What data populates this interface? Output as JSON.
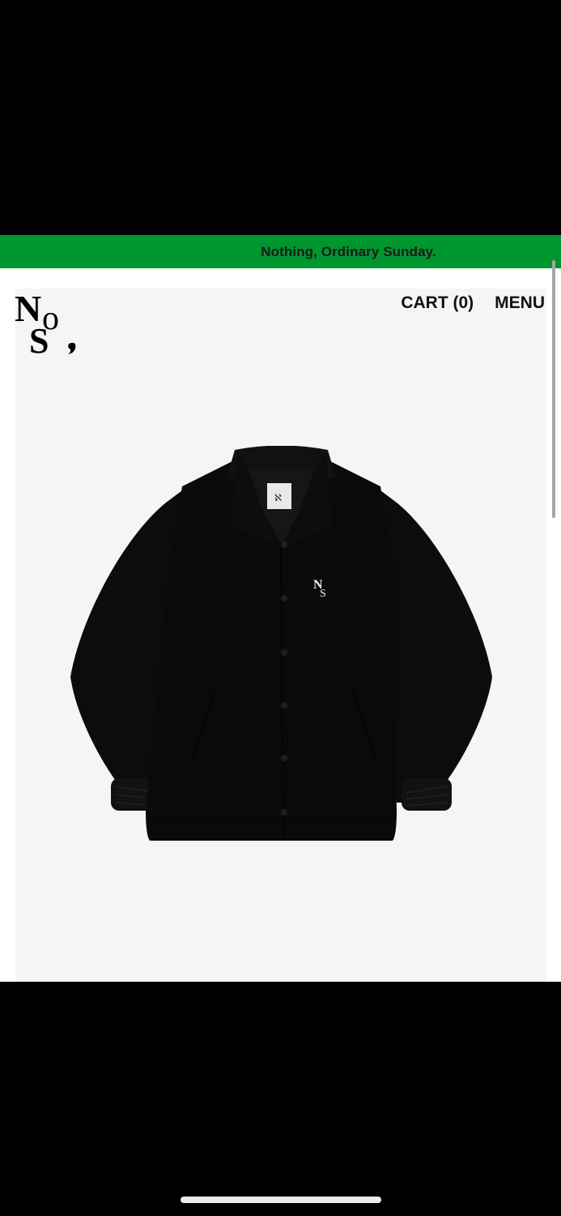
{
  "banner": {
    "text": "Nothing, Ordinary Sunday.",
    "background_color": "#00962f"
  },
  "header": {
    "logo_icon": "nos-monogram-logo-icon",
    "cart_label": "CART (0)",
    "menu_label": "MENU"
  },
  "product": {
    "image_icon": "black-coach-jacket-image",
    "background_color": "#f5f5f5"
  },
  "colors": {
    "accent": "#00962f",
    "text": "#111111",
    "frame": "#000000"
  }
}
